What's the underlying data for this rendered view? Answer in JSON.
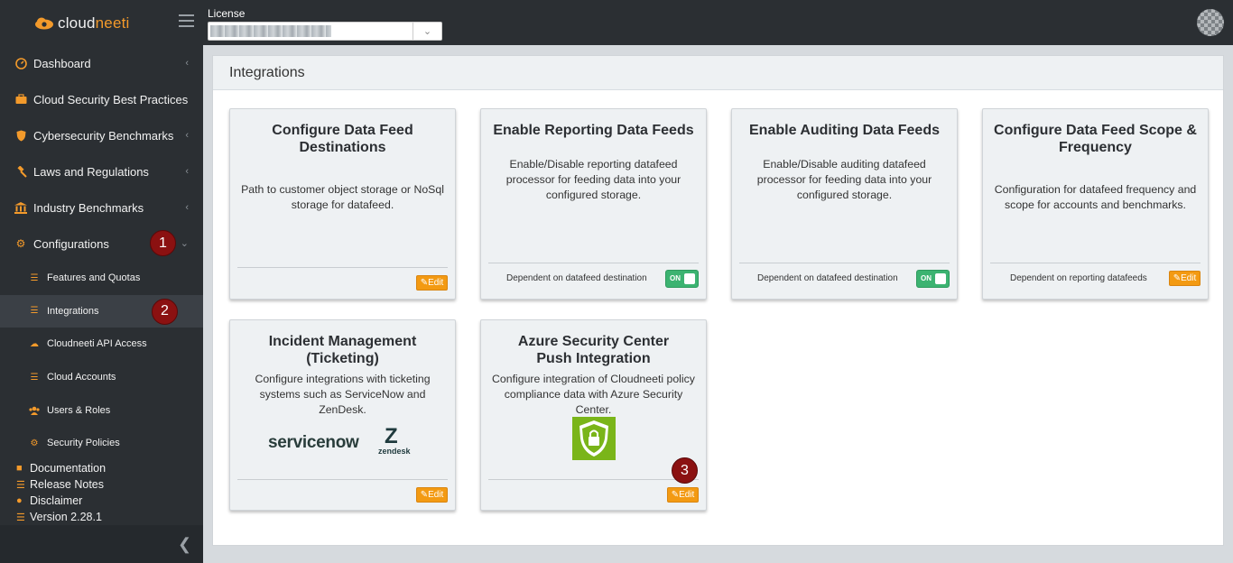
{
  "app": {
    "brand_prefix": "cloud",
    "brand_suffix": "neeti"
  },
  "topbar": {
    "license_label": "License"
  },
  "sidebar": {
    "items": [
      {
        "label": "Dashboard",
        "icon": "gauge-icon"
      },
      {
        "label": "Cloud Security Best Practices",
        "icon": "briefcase-icon"
      },
      {
        "label": "Cybersecurity Benchmarks",
        "icon": "shield-icon"
      },
      {
        "label": "Laws and Regulations",
        "icon": "gavel-icon"
      },
      {
        "label": "Industry Benchmarks",
        "icon": "bank-icon"
      },
      {
        "label": "Configurations",
        "icon": "gear-icon"
      }
    ],
    "sub_items": [
      {
        "label": "Features and Quotas",
        "icon": "list-icon"
      },
      {
        "label": "Integrations",
        "icon": "list-icon"
      },
      {
        "label": "Cloudneeti API Access",
        "icon": "cloud-gears-icon"
      },
      {
        "label": "Cloud Accounts",
        "icon": "list-icon"
      },
      {
        "label": "Users & Roles",
        "icon": "users-icon"
      },
      {
        "label": "Security Policies",
        "icon": "gears-icon"
      }
    ],
    "links": [
      {
        "label": "Documentation",
        "icon": "book-icon"
      },
      {
        "label": "Release Notes",
        "icon": "list-icon"
      },
      {
        "label": "Disclaimer",
        "icon": "exclamation-icon"
      },
      {
        "label": "Version 2.28.1",
        "icon": "list-icon"
      }
    ]
  },
  "annotations": [
    "1",
    "2",
    "3"
  ],
  "main": {
    "title": "Integrations",
    "cards": [
      {
        "title": "Configure Data Feed Destinations",
        "description": "Path to customer object storage or NoSql storage for datafeed.",
        "footer": "",
        "action": "Edit"
      },
      {
        "title": "Enable Reporting Data Feeds",
        "description": "Enable/Disable reporting datafeed processor for feeding data into your configured storage.",
        "footer": "Dependent on datafeed destination",
        "action": "ON"
      },
      {
        "title": "Enable Auditing Data Feeds",
        "description": "Enable/Disable auditing datafeed processor for feeding data into your configured storage.",
        "footer": "Dependent on datafeed destination",
        "action": "ON"
      },
      {
        "title": "Configure Data Feed Scope & Frequency",
        "description": "Configuration for datafeed frequency and scope for accounts and benchmarks.",
        "footer": "Dependent on reporting datafeeds",
        "action": "Edit"
      },
      {
        "title": "Incident Management (Ticketing)",
        "description": "Configure integrations with ticketing systems such as ServiceNow and ZenDesk.",
        "footer": "",
        "action": "Edit",
        "logo_servicenow": "servicenow",
        "logo_zendesk": "zendesk"
      },
      {
        "title": "Azure Security Center Push Integration",
        "description": "Configure integration of Cloudneeti policy compliance data with Azure Security Center.",
        "footer": "",
        "action": "Edit"
      }
    ]
  },
  "colors": {
    "sidebar_bg": "#2b2f33",
    "accent": "#f39a2b",
    "edit_button": "#f39a12",
    "toggle_on": "#3cb371",
    "badge": "#8b1111"
  }
}
